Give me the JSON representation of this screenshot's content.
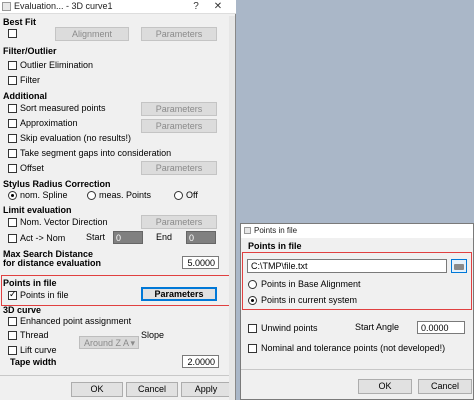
{
  "dialog1": {
    "title": "Evaluation... - 3D curve1",
    "best_fit": {
      "header": "Best Fit",
      "alignment_btn": "Alignment",
      "parameters_btn": "Parameters"
    },
    "filter": {
      "header": "Filter/Outlier",
      "outlier": "Outlier Elimination",
      "filter": "Filter"
    },
    "additional": {
      "header": "Additional",
      "sort": "Sort measured points",
      "sort_btn": "Parameters",
      "approx": "Approximation",
      "approx_btn": "Parameters",
      "skip": "Skip evaluation (no results!)",
      "gaps": "Take segment gaps into consideration",
      "offset": "Offset",
      "offset_btn": "Parameters"
    },
    "stylus": {
      "header": "Stylus Radius Correction",
      "opt1": "nom. Spline",
      "opt2": "meas. Points",
      "opt3": "Off"
    },
    "limit": {
      "header": "Limit evaluation",
      "nom_vec": "Nom. Vector Direction",
      "nom_vec_btn": "Parameters",
      "act_nom": "Act -> Nom",
      "start_label": "Start",
      "start_val": "0",
      "end_label": "End",
      "end_val": "0"
    },
    "max_search": {
      "line1": "Max Search Distance",
      "line2": "for distance evaluation",
      "value": "5.0000"
    },
    "points_in_file": {
      "header": "Points in file",
      "checkbox": "Points in file",
      "params_btn": "Parameters"
    },
    "curve3d": {
      "header": "3D curve",
      "enhanced": "Enhanced point assignment",
      "thread": "Thread",
      "slope_label": "Slope",
      "lift": "Lift curve",
      "axis_select": "Around Z A",
      "tape_label": "Tape width",
      "tape_value": "2.0000"
    },
    "footer": {
      "ok": "OK",
      "cancel": "Cancel",
      "apply": "Apply"
    }
  },
  "dialog2": {
    "title": "Points in file",
    "section": "Points in file",
    "file_path": "C:\\TMP\\file.txt",
    "radio1": "Points in Base Alignment",
    "radio2": "Points in current system",
    "unwind": "Unwind points",
    "start_angle_label": "Start Angle",
    "start_angle_value": "0.0000",
    "nominal": "Nominal and tolerance points (not developed!)",
    "ok": "OK",
    "cancel": "Cancel"
  },
  "colors": {
    "highlight_box": "#e04040",
    "focus_blue": "#0078d7",
    "desktop": "#a9b6c7"
  }
}
